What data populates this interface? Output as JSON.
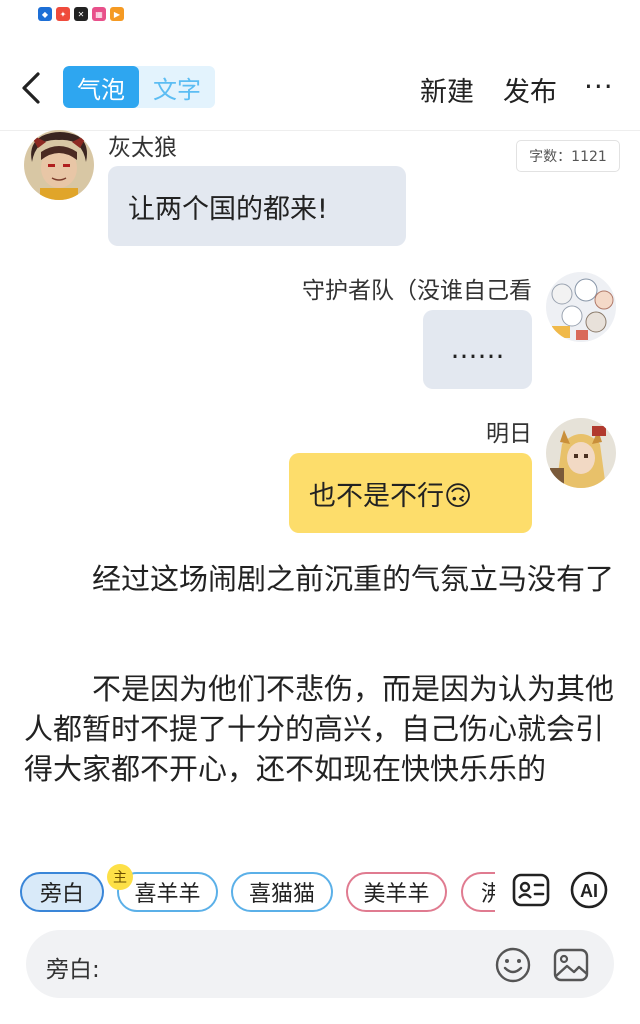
{
  "status_icons": [
    "shield-app-icon",
    "red-app-icon",
    "capcut-icon",
    "pink-app-icon",
    "orange-play-icon"
  ],
  "header": {
    "tab_bubble": "气泡",
    "tab_text": "文字",
    "new_label": "新建",
    "publish_label": "发布",
    "more_label": "···"
  },
  "word_count": "字数：1121",
  "messages": [
    {
      "sender": "灰太狼",
      "text": "让两个国的都来!",
      "side": "left"
    },
    {
      "sender": "守护者队（没谁自己看",
      "text": "……",
      "side": "right"
    },
    {
      "sender": "明日",
      "text": "也不是不行🙃",
      "side": "right"
    }
  ],
  "narration": [
    "经过这场闹剧之前沉重的气氛立马没有了",
    "不是因为他们不悲伤，而是因为认为其他人都暂时不提了十分的高兴，自己伤心就会引得大家都不开心，还不如现在快快乐乐的"
  ],
  "roles": [
    {
      "label": "旁白",
      "style": "selected"
    },
    {
      "label": "喜羊羊",
      "style": "blue",
      "badge": "主"
    },
    {
      "label": "喜猫猫",
      "style": "blue"
    },
    {
      "label": "美羊羊",
      "style": "red"
    },
    {
      "label": "沸",
      "style": "red"
    }
  ],
  "input": {
    "label": "旁白:"
  },
  "colors": {
    "accent_blue": "#2ea6f0",
    "bubble_gray": "#e3e8f0",
    "bubble_yellow": "#fddd6b"
  }
}
